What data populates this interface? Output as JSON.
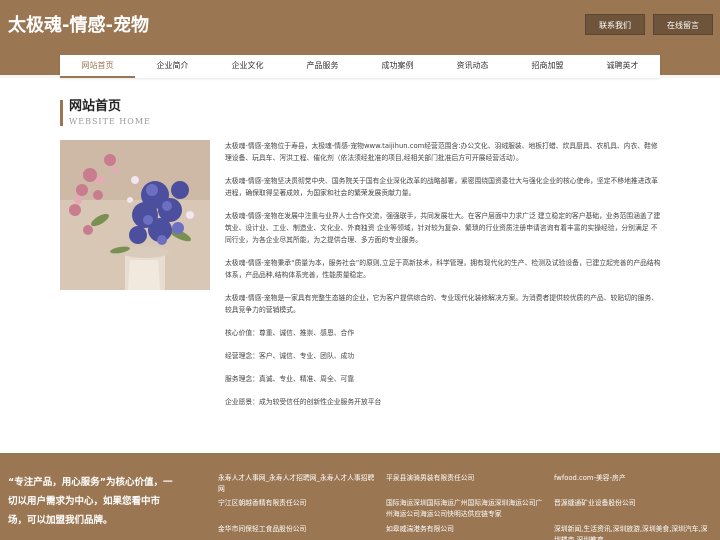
{
  "header": {
    "title": "太极魂-情感-宠物",
    "contact_label": "联系我们",
    "message_label": "在线留言"
  },
  "nav": {
    "items": [
      "网站首页",
      "企业简介",
      "企业文化",
      "产品服务",
      "成功案例",
      "资讯动态",
      "招商加盟",
      "诚聘英才"
    ],
    "active": "网站首页"
  },
  "section": {
    "title_cn": "网站首页",
    "title_en": "WEBSITE HOME"
  },
  "content": {
    "paragraphs": [
      "太极魂-情感-宠物位于寿县，太极魂-情感-宠物www.taijihun.com经营范围含:办公文化、羽绒服装、地板打蜡、炊具厨具、农机具、内衣、鞋修理设备、玩具车、泻洪工程、催化剂（依法须经批准的项目,经相关部门批准后方可开展经营活动）。",
      "太极魂-情感-宠物坚决贯彻党中央、国务院关于国有企业深化改革的战略部署，紧密围绕国资委壮大与强化企业的核心使命，坚定不移地推进改革进程，确保取得显著成效，为国家和社会的繁荣发展贡献力量。",
      "太极魂-情感-宠物在发展中注重与业界人士合作交流，强强联手，共同发展壮大。在客户层面中力求广泛 建立稳定的客户基础，业务范围涵盖了建筑业、设计业、工业、制造业、文化业、外商独资 企业等领域，针对较为复杂、繁琐的行业资质注册申请咨询有着丰富的实操经验，分别满足 不同行业，为各企业尽其所能，为之提供合理、多方面的专业服务。",
      "太极魂-情感-宠物秉承“质量为本，服务社会”的原则,立足于高新技术，科学管理，拥有现代化的生产、检测及试验设备，已建立起完善的产品结构体系，产品品种,结构体系完善，性能质量稳定。",
      "太极魂-情感-宠物是一家具有完整生态链的企业，它为客户提供综合的、专业现代化装修解决方案。为消费者提供较优质的产品、较贴切的服务、较具竞争力的营销模式。",
      "核心价值：尊重、诚信、推崇、感恩、合作",
      "经营理念：客户、诚信、专业、团队、成功",
      "服务理念：真诚、专业、精准、周全、可靠",
      "企业愿景：成为较受信任的创新性企业服务开放平台"
    ]
  },
  "footer": {
    "slogan": "“专注产品，用心服务”为核心价值，一切以用户需求为中心，如果您看中市场，可以加盟我们品牌。",
    "links": [
      "永寿人才人事网_永寿人才招聘网_永寿人才人事招聘网",
      "平泉县演骑男装有限责任公司",
      "fwfood.com-美容-房产",
      "宁江区朝越香精有限责任公司",
      "国际海运深圳国际海运广州国际海运深圳海运公司广州海运公司海运公司快明达供应链专家",
      "晋源缝通矿业设备股份公司",
      "金华市间保轻工食品股份公司",
      "如皋威湍港务有限公司",
      "深圳新闻,生活资讯,深圳旅游,深圳美食,深圳汽车,深圳楼市,深圳教育"
    ]
  },
  "colors": {
    "brand": "#9a7653",
    "brand_dark": "#6e543a"
  }
}
